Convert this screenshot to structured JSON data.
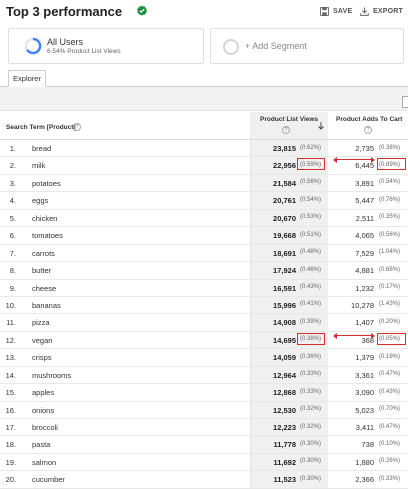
{
  "header": {
    "title": "Top 3 performance",
    "save_label": "SAVE",
    "export_label": "EXPORT",
    "verified_color": "#1e8e3e",
    "accent_color": "#4285f4"
  },
  "segments": {
    "primary": {
      "name": "All Users",
      "subtitle": "6.54% Product List Views"
    },
    "add_label": "+ Add Segment"
  },
  "tabs": {
    "active": "Explorer"
  },
  "table": {
    "headers": {
      "dimension": "Search Term [Product]",
      "metric1": "Product List Views",
      "metric2": "Product Adds To Cart"
    },
    "rows": [
      {
        "num": "1.",
        "term": "bread",
        "plv": "23,815",
        "plv_pct": "(0.62%)",
        "atc": "2,735",
        "atc_pct": "(0.38%)"
      },
      {
        "num": "2.",
        "term": "milk",
        "plv": "22,956",
        "plv_pct": "(0.59%)",
        "atc": "6,445",
        "atc_pct": "(0.89%)"
      },
      {
        "num": "3.",
        "term": "potatoes",
        "plv": "21,584",
        "plv_pct": "(0.56%)",
        "atc": "3,891",
        "atc_pct": "(0.54%)"
      },
      {
        "num": "4.",
        "term": "eggs",
        "plv": "20,761",
        "plv_pct": "(0.54%)",
        "atc": "5,447",
        "atc_pct": "(0.76%)"
      },
      {
        "num": "5.",
        "term": "chicken",
        "plv": "20,670",
        "plv_pct": "(0.53%)",
        "atc": "2,511",
        "atc_pct": "(0.35%)"
      },
      {
        "num": "6.",
        "term": "tomatoes",
        "plv": "19,668",
        "plv_pct": "(0.51%)",
        "atc": "4,065",
        "atc_pct": "(0.56%)"
      },
      {
        "num": "7.",
        "term": "carrots",
        "plv": "18,691",
        "plv_pct": "(0.48%)",
        "atc": "7,529",
        "atc_pct": "(1.04%)"
      },
      {
        "num": "8.",
        "term": "butter",
        "plv": "17,924",
        "plv_pct": "(0.46%)",
        "atc": "4,881",
        "atc_pct": "(0.68%)"
      },
      {
        "num": "9.",
        "term": "cheese",
        "plv": "16,591",
        "plv_pct": "(0.43%)",
        "atc": "1,232",
        "atc_pct": "(0.17%)"
      },
      {
        "num": "10.",
        "term": "bananas",
        "plv": "15,996",
        "plv_pct": "(0.41%)",
        "atc": "10,278",
        "atc_pct": "(1.43%)"
      },
      {
        "num": "11.",
        "term": "pizza",
        "plv": "14,908",
        "plv_pct": "(0.39%)",
        "atc": "1,407",
        "atc_pct": "(0.20%)"
      },
      {
        "num": "12.",
        "term": "vegan",
        "plv": "14,695",
        "plv_pct": "(0.38%)",
        "atc": "368",
        "atc_pct": "(0.05%)"
      },
      {
        "num": "13.",
        "term": "crisps",
        "plv": "14,059",
        "plv_pct": "(0.36%)",
        "atc": "1,379",
        "atc_pct": "(0.19%)"
      },
      {
        "num": "14.",
        "term": "mushrooms",
        "plv": "12,964",
        "plv_pct": "(0.33%)",
        "atc": "3,361",
        "atc_pct": "(0.47%)"
      },
      {
        "num": "15.",
        "term": "apples",
        "plv": "12,868",
        "plv_pct": "(0.33%)",
        "atc": "3,090",
        "atc_pct": "(0.43%)"
      },
      {
        "num": "16.",
        "term": "onions",
        "plv": "12,530",
        "plv_pct": "(0.32%)",
        "atc": "5,023",
        "atc_pct": "(0.70%)"
      },
      {
        "num": "17.",
        "term": "broccoli",
        "plv": "12,223",
        "plv_pct": "(0.32%)",
        "atc": "3,411",
        "atc_pct": "(0.47%)"
      },
      {
        "num": "18.",
        "term": "pasta",
        "plv": "11,778",
        "plv_pct": "(0.30%)",
        "atc": "738",
        "atc_pct": "(0.10%)"
      },
      {
        "num": "19.",
        "term": "salmon",
        "plv": "11,692",
        "plv_pct": "(0.30%)",
        "atc": "1,880",
        "atc_pct": "(0.26%)"
      },
      {
        "num": "20.",
        "term": "cucumber",
        "plv": "11,523",
        "plv_pct": "(0.30%)",
        "atc": "2,366",
        "atc_pct": "(0.33%)"
      }
    ],
    "annotation_color": "#d32f2f"
  }
}
